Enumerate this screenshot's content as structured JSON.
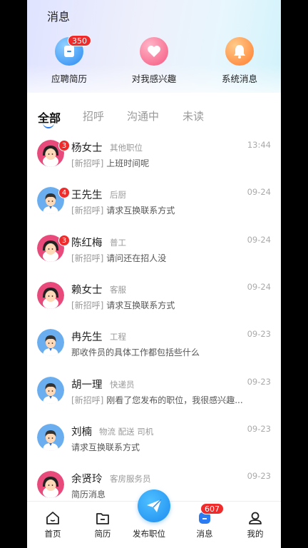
{
  "page": {
    "title": "消息"
  },
  "quick": [
    {
      "label": "应聘简历",
      "icon": "resume-icon",
      "badge": "350",
      "color": "#2b8af2"
    },
    {
      "label": "对我感兴趣",
      "icon": "heart-icon",
      "badge": "",
      "color": "#f5577f"
    },
    {
      "label": "系统消息",
      "icon": "bell-icon",
      "badge": "",
      "color": "#ff7c2e"
    }
  ],
  "tabs": [
    {
      "label": "全部",
      "active": true
    },
    {
      "label": "招呼",
      "active": false
    },
    {
      "label": "沟通中",
      "active": false
    },
    {
      "label": "未读",
      "active": false
    }
  ],
  "messages": [
    {
      "name": "杨女士",
      "role": "其他职位",
      "time": "13:44",
      "tag": "[新招呼]",
      "text": "上班时间呢",
      "unread": "3",
      "avatar": "female-avatar-icon"
    },
    {
      "name": "王先生",
      "role": "后厨",
      "time": "09-24",
      "tag": "[新招呼]",
      "text": "请求互换联系方式",
      "unread": "4",
      "avatar": "male-avatar-icon"
    },
    {
      "name": "陈红梅",
      "role": "普工",
      "time": "09-24",
      "tag": "[新招呼]",
      "text": "请问还在招人没",
      "unread": "3",
      "avatar": "female-avatar-icon"
    },
    {
      "name": "赖女士",
      "role": "客服",
      "time": "09-24",
      "tag": "[新招呼]",
      "text": "请求互换联系方式",
      "unread": "",
      "avatar": "female-avatar-icon"
    },
    {
      "name": "冉先生",
      "role": "工程",
      "time": "09-23",
      "tag": "",
      "text": "那收件员的具体工作都包括些什么",
      "unread": "",
      "avatar": "male-avatar-icon"
    },
    {
      "name": "胡一理",
      "role": "快递员",
      "time": "09-23",
      "tag": "[新招呼]",
      "text": "刚看了您发布的职位，我很感兴趣...",
      "unread": "",
      "avatar": "male-avatar-icon"
    },
    {
      "name": "刘楠",
      "role": "物流 配送 司机",
      "time": "09-23",
      "tag": "",
      "text": "请求互换联系方式",
      "unread": "",
      "avatar": "male-avatar-icon"
    },
    {
      "name": "余贤玲",
      "role": "客房服务员",
      "time": "09-23",
      "tag": "",
      "text": "简历消息",
      "unread": "",
      "avatar": "female-avatar-icon"
    }
  ],
  "tabbar": {
    "home": "首页",
    "resume": "简历",
    "publish": "发布职位",
    "messages": "消息",
    "messages_badge": "607",
    "mine": "我的"
  },
  "colors": {
    "accent": "#2b7cf2",
    "badge": "#ef2b2b"
  }
}
